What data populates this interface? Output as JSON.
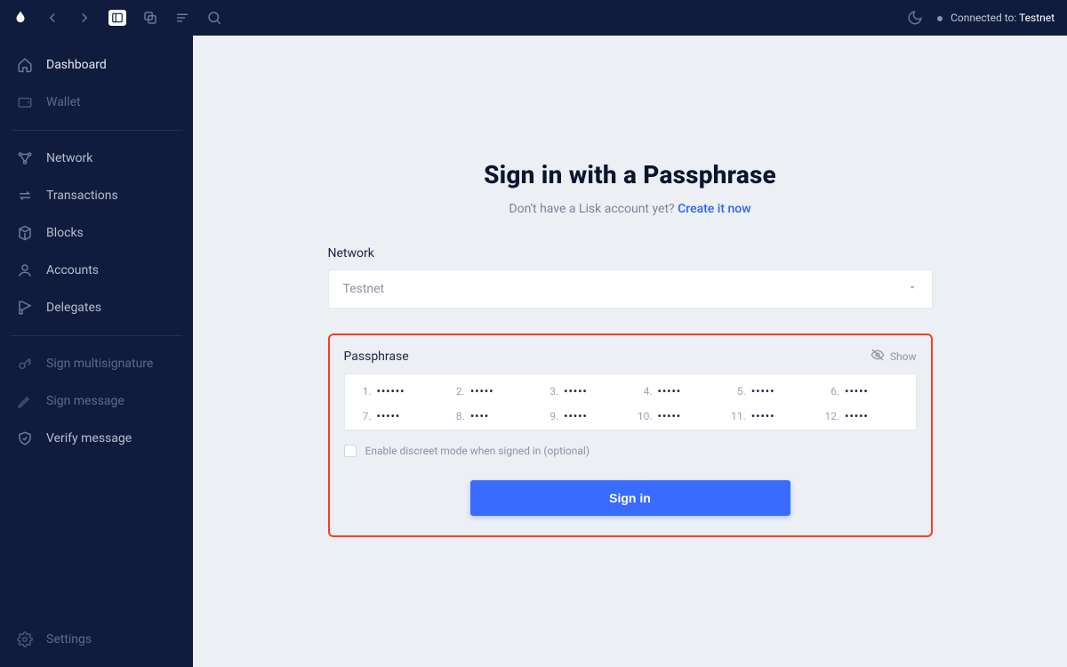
{
  "topbar": {
    "connected_label": "Connected to:",
    "connected_target": "Testnet"
  },
  "sidebar": {
    "group1": [
      {
        "label": "Dashboard"
      },
      {
        "label": "Wallet"
      }
    ],
    "group2": [
      {
        "label": "Network"
      },
      {
        "label": "Transactions"
      },
      {
        "label": "Blocks"
      },
      {
        "label": "Accounts"
      },
      {
        "label": "Delegates"
      }
    ],
    "group3": [
      {
        "label": "Sign multisignature"
      },
      {
        "label": "Sign message"
      },
      {
        "label": "Verify message"
      }
    ],
    "settings_label": "Settings"
  },
  "signin": {
    "title": "Sign in with a Passphrase",
    "subtitle_prefix": "Don't have a Lisk account yet? ",
    "subtitle_link": "Create it now",
    "network_label": "Network",
    "network_value": "Testnet",
    "passphrase_label": "Passphrase",
    "show_label": "Show",
    "discreet_label": "Enable discreet mode when signed in (optional)",
    "button_label": "Sign in",
    "words": [
      {
        "n": "1.",
        "mask": "••••••"
      },
      {
        "n": "2.",
        "mask": "•••••"
      },
      {
        "n": "3.",
        "mask": "•••••"
      },
      {
        "n": "4.",
        "mask": "•••••"
      },
      {
        "n": "5.",
        "mask": "•••••"
      },
      {
        "n": "6.",
        "mask": "•••••"
      },
      {
        "n": "7.",
        "mask": "•••••"
      },
      {
        "n": "8.",
        "mask": "••••"
      },
      {
        "n": "9.",
        "mask": "•••••"
      },
      {
        "n": "10.",
        "mask": "•••••"
      },
      {
        "n": "11.",
        "mask": "•••••"
      },
      {
        "n": "12.",
        "mask": "•••••"
      }
    ]
  }
}
